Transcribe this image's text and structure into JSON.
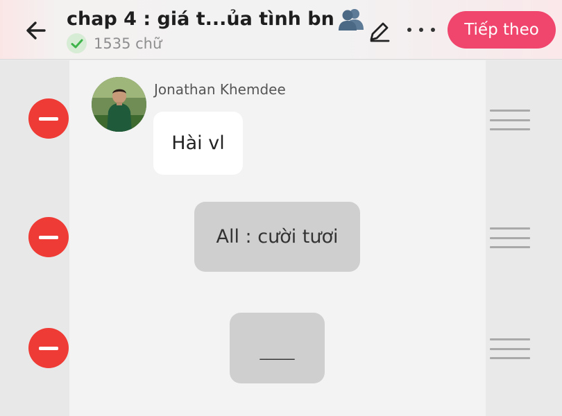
{
  "header": {
    "title": "chap 4 : giá t...ủa tình bn",
    "title_emoji": "busts-in-silhouette-icon",
    "word_count": "1535 chữ",
    "next_label": "Tiếp theo",
    "accent_color": "#f0456c"
  },
  "messages": [
    {
      "type": "character",
      "speaker": "Jonathan Khemdee",
      "text": "Hài vl",
      "bubble_color": "#ffffff"
    },
    {
      "type": "narration",
      "text": "All : cười tươi",
      "bubble_color": "#cfcfcf"
    },
    {
      "type": "narration",
      "text": "_____",
      "bubble_color": "#cfcfcf"
    }
  ],
  "icons": {
    "back": "arrow-left-icon",
    "status": "check-icon",
    "edit": "pencil-icon",
    "more": "more-horizontal-icon",
    "remove": "minus-circle-icon",
    "reorder": "drag-handle-icon"
  },
  "colors": {
    "remove": "#ef3b35",
    "check": "#3fb44a"
  }
}
